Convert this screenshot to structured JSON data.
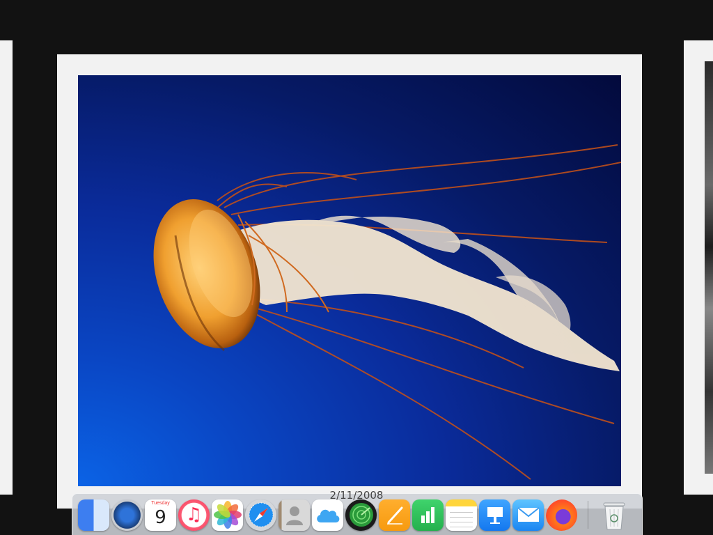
{
  "slideshow": {
    "current_photo": {
      "caption_date": "2/11/2008",
      "subject": "jellyfish"
    }
  },
  "dock": {
    "apps": [
      {
        "name": "Finder",
        "icon": "finder-icon"
      },
      {
        "name": "Launchpad",
        "icon": "launchpad-icon"
      },
      {
        "name": "Calendar",
        "icon": "calendar-icon",
        "month_label": "Tuesday",
        "day": "9"
      },
      {
        "name": "Music",
        "icon": "music-icon",
        "glyph": "♫"
      },
      {
        "name": "Photos",
        "icon": "photos-icon"
      },
      {
        "name": "Safari",
        "icon": "safari-icon"
      },
      {
        "name": "Contacts",
        "icon": "contacts-icon"
      },
      {
        "name": "iCloud",
        "icon": "icloud-icon"
      },
      {
        "name": "Find My",
        "icon": "find-my-icon"
      },
      {
        "name": "Pages",
        "icon": "pages-icon"
      },
      {
        "name": "Numbers",
        "icon": "numbers-icon"
      },
      {
        "name": "Notes",
        "icon": "notes-icon"
      },
      {
        "name": "Keynote",
        "icon": "keynote-icon"
      },
      {
        "name": "Mail",
        "icon": "mail-icon"
      },
      {
        "name": "Firefox",
        "icon": "firefox-icon"
      }
    ],
    "trash": {
      "name": "Trash",
      "icon": "trash-icon"
    }
  },
  "colors": {
    "background": "#121212",
    "frame": "#f2f2f2",
    "water_light": "#0b63e6",
    "water_dark": "#030a3c",
    "jelly_bell": "#f0a030",
    "tentacle": "#c0501a"
  }
}
